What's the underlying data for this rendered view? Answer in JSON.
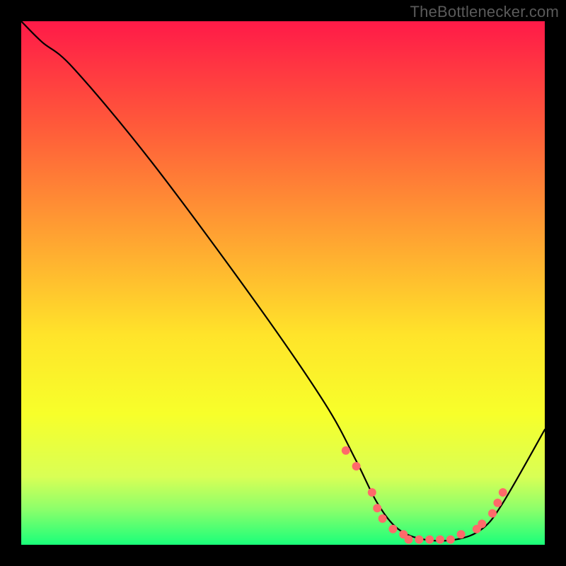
{
  "attribution": "TheBottlenecker.com",
  "chart_data": {
    "type": "line",
    "title": "",
    "xlabel": "",
    "ylabel": "",
    "xlim": [
      0,
      100
    ],
    "ylim": [
      0,
      100
    ],
    "gradient_stops": [
      {
        "offset": 0,
        "color": "#ff1a48"
      },
      {
        "offset": 20,
        "color": "#ff5a3a"
      },
      {
        "offset": 45,
        "color": "#ffb030"
      },
      {
        "offset": 60,
        "color": "#ffe42a"
      },
      {
        "offset": 75,
        "color": "#f7ff2a"
      },
      {
        "offset": 87,
        "color": "#d9ff55"
      },
      {
        "offset": 93,
        "color": "#8fff6a"
      },
      {
        "offset": 100,
        "color": "#1aff7a"
      }
    ],
    "series": [
      {
        "name": "bottleneck-curve",
        "x": [
          0,
          4,
          10,
          25,
          45,
          58,
          64,
          68,
          72,
          77,
          83,
          88,
          92,
          100
        ],
        "y": [
          100,
          96,
          91,
          73,
          46,
          27,
          16,
          8,
          3,
          1,
          1,
          3,
          8,
          22
        ]
      }
    ],
    "markers": {
      "name": "sweet-zone-dots",
      "color": "#ff6a6a",
      "radius_px": 6,
      "points": [
        {
          "x": 62,
          "y": 18
        },
        {
          "x": 64,
          "y": 15
        },
        {
          "x": 67,
          "y": 10
        },
        {
          "x": 68,
          "y": 7
        },
        {
          "x": 69,
          "y": 5
        },
        {
          "x": 71,
          "y": 3
        },
        {
          "x": 73,
          "y": 2
        },
        {
          "x": 74,
          "y": 1
        },
        {
          "x": 76,
          "y": 1
        },
        {
          "x": 78,
          "y": 1
        },
        {
          "x": 80,
          "y": 1
        },
        {
          "x": 82,
          "y": 1
        },
        {
          "x": 84,
          "y": 2
        },
        {
          "x": 87,
          "y": 3
        },
        {
          "x": 88,
          "y": 4
        },
        {
          "x": 90,
          "y": 6
        },
        {
          "x": 91,
          "y": 8
        },
        {
          "x": 92,
          "y": 10
        }
      ]
    }
  }
}
